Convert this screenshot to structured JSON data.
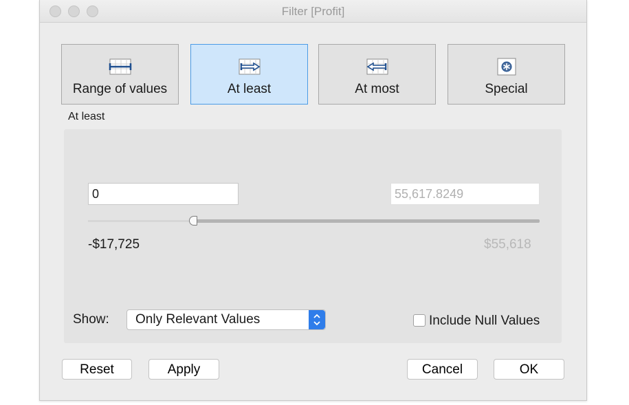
{
  "window": {
    "title": "Filter [Profit]"
  },
  "modes": [
    {
      "label": "Range of values",
      "icon": "range-icon",
      "selected": false
    },
    {
      "label": "At least",
      "icon": "at-least-icon",
      "selected": true
    },
    {
      "label": "At most",
      "icon": "at-most-icon",
      "selected": false
    },
    {
      "label": "Special",
      "icon": "special-icon",
      "selected": false
    }
  ],
  "section_label": "At least",
  "range": {
    "min_value": "0",
    "max_value": "55,617.8249",
    "min_label": "-$17,725",
    "max_label": "$55,618"
  },
  "show": {
    "label": "Show:",
    "selected": "Only Relevant Values"
  },
  "include_null": {
    "label": "Include Null Values",
    "checked": false
  },
  "buttons": {
    "reset": "Reset",
    "apply": "Apply",
    "cancel": "Cancel",
    "ok": "OK"
  },
  "colors": {
    "accent": "#2f7dea",
    "selected_bg": "#cfe6fb",
    "selected_border": "#4a9be6"
  }
}
